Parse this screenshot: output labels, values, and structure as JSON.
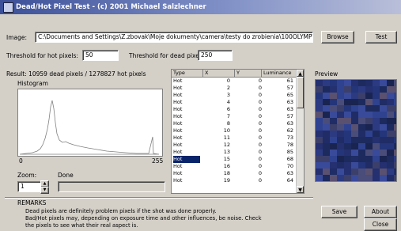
{
  "window": {
    "title": "Dead/Hot Pixel Test - (c) 2001 Michael Salzlechner"
  },
  "image_row": {
    "label": "Image:",
    "path": "C:\\Documents and Settings\\Z.zbovak\\Moje dokumenty\\camera\\testy do zrobienia\\100OLYMP\\P1010022.TIF",
    "browse_label": "Browse",
    "test_label": "Test"
  },
  "thresholds": {
    "hot_label": "Threshold for hot pixels:",
    "hot_value": "50",
    "dead_label": "Threshold for dead pixels:",
    "dead_value": "250"
  },
  "result": {
    "text": "Result:  10959 dead pixels / 1278827 hot pixels"
  },
  "histogram": {
    "label": "Histogram",
    "axis_min": "0",
    "axis_max": "255",
    "fill_color": "#ffffff",
    "stroke_color": "#808080"
  },
  "zoom": {
    "label": "Zoom:",
    "value": "1",
    "done_label": "Done"
  },
  "table": {
    "columns": [
      "Type",
      "X",
      "Y",
      "Luminance"
    ],
    "rows": [
      [
        "Hot",
        "0",
        "0",
        "61"
      ],
      [
        "Hot",
        "2",
        "0",
        "57"
      ],
      [
        "Hot",
        "3",
        "0",
        "65"
      ],
      [
        "Hot",
        "4",
        "0",
        "63"
      ],
      [
        "Hot",
        "6",
        "0",
        "63"
      ],
      [
        "Hot",
        "7",
        "0",
        "57"
      ],
      [
        "Hot",
        "8",
        "0",
        "63"
      ],
      [
        "Hot",
        "10",
        "0",
        "62"
      ],
      [
        "Hot",
        "11",
        "0",
        "73"
      ],
      [
        "Hot",
        "12",
        "0",
        "78"
      ],
      [
        "Hot",
        "13",
        "0",
        "85"
      ],
      [
        "Hot",
        "15",
        "0",
        "68"
      ],
      [
        "Hot",
        "16",
        "0",
        "70"
      ],
      [
        "Hot",
        "18",
        "0",
        "63"
      ],
      [
        "Hot",
        "19",
        "0",
        "64"
      ]
    ],
    "selected_row": 11
  },
  "preview": {
    "label": "Preview"
  },
  "remarks": {
    "label": "REMARKS",
    "line1": "Dead pixels are definitely problem pixels if the shot was done properly.",
    "line2": "Bad/Hot pixels may, depending on exposure time and other influences, be noise. Check",
    "line3": "the pixels to see what their real aspect is."
  },
  "buttons": {
    "save": "Save",
    "about": "About",
    "close": "Close"
  },
  "colors": {
    "title_start": "#3b4f98",
    "title_end": "#b9bfd9",
    "selection": "#0a246a",
    "face": "#d4d0c8"
  }
}
